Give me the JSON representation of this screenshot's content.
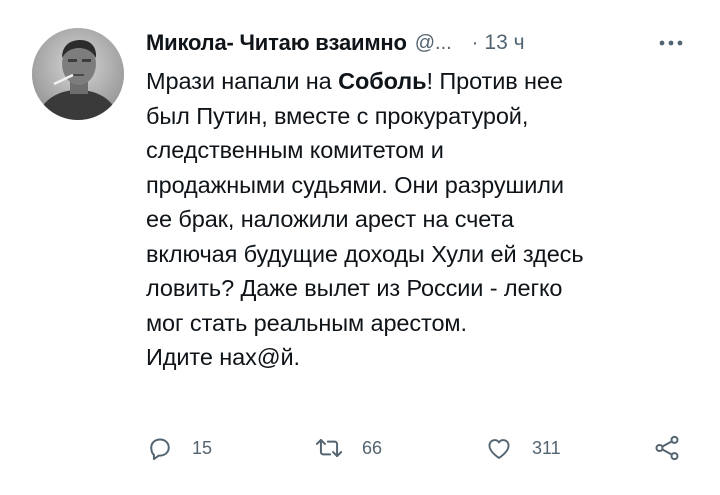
{
  "tweet": {
    "author": {
      "name": "Микола- Читаю взаимно",
      "handle": "@...",
      "avatar_icon": "user-avatar-photo"
    },
    "separator": "·",
    "time": "13 ч",
    "more_icon": "more-horizontal-icon",
    "text": {
      "line1_pre": "Мрази напали на ",
      "line1_bold": "Соболь",
      "line1_post": "! Против нее",
      "line2": "был Путин, вместе с прокуратурой,",
      "line3": "следственным комитетом и",
      "line4": "продажными судьями. Они разрушили",
      "line5": "ее брак, наложили арест на счета",
      "line6": "включая будущие доходы Хули ей здесь",
      "line7": "ловить? Даже вылет из России - легко",
      "line8": "мог стать реальным арестом.",
      "line9": "Идите нах@й."
    },
    "actions": {
      "reply": {
        "icon": "reply-icon",
        "count": "15"
      },
      "retweet": {
        "icon": "retweet-icon",
        "count": "66"
      },
      "like": {
        "icon": "heart-icon",
        "count": "311"
      },
      "share": {
        "icon": "share-icon"
      }
    },
    "colors": {
      "text": "#0f1419",
      "secondary": "#536471",
      "background": "#ffffff"
    }
  }
}
